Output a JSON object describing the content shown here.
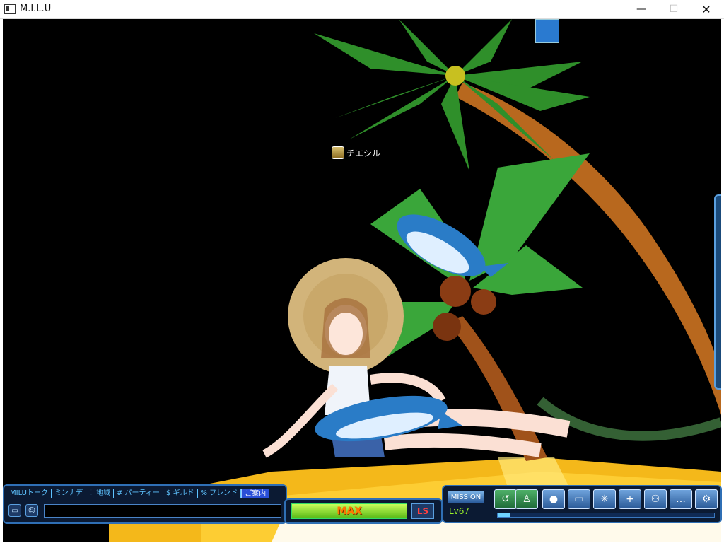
{
  "window": {
    "title": "M.I.L.U",
    "controls": {
      "minimize": "—",
      "maximize": "☐",
      "close": "✕"
    }
  },
  "scene": {
    "character_name": "チエシル"
  },
  "chat": {
    "tabs": [
      {
        "label": "MILUトーク"
      },
      {
        "label": "ミンナデ"
      },
      {
        "label": "！地域"
      },
      {
        "label": "# パーティー"
      },
      {
        "label": "$ ギルド"
      },
      {
        "label": "% フレンド"
      },
      {
        "label": "ご案内",
        "active": true
      }
    ],
    "input_value": ""
  },
  "gauge": {
    "label": "MAX",
    "value_percent": 100,
    "ls_label": "LS"
  },
  "menu": {
    "mission_label": "MISSION",
    "level_label": "Lv67",
    "icons": [
      "warp-icon",
      "pose-icon",
      "character-icon",
      "vehicle-icon",
      "effect-icon",
      "add-friend-icon",
      "party-icon",
      "chat-bubble-icon",
      "settings-icon"
    ],
    "exp_percent": 6
  },
  "colors": {
    "panel_bg": "#0b1a33",
    "panel_border": "#2f6fb5",
    "gauge_text": "#ff7a00",
    "level_text": "#9bf02a",
    "chat_tab_text": "#5ec3ff"
  }
}
